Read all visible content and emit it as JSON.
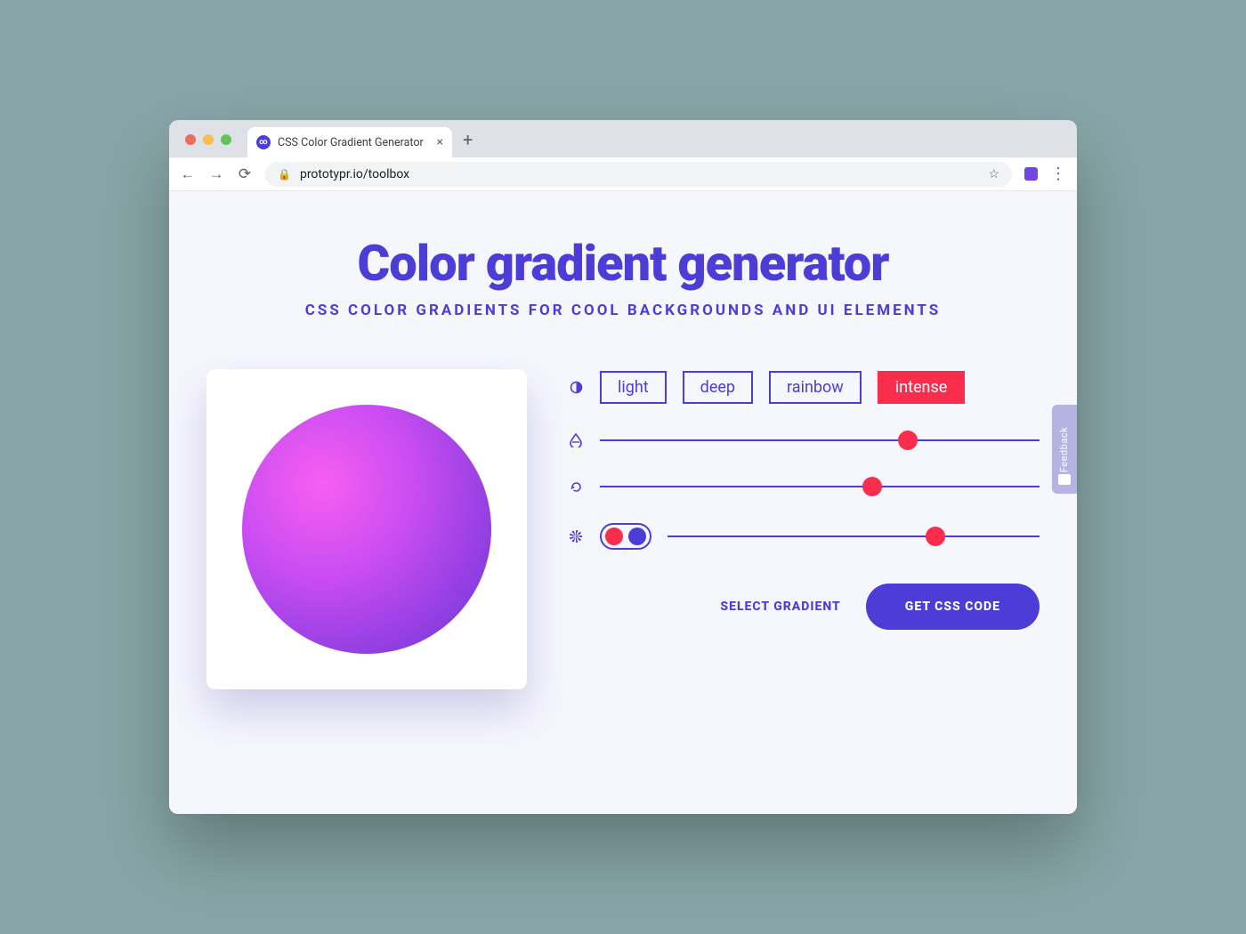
{
  "browser": {
    "tab_title": "CSS Color Gradient Generator",
    "url": "prototypr.io/toolbox"
  },
  "page": {
    "title": "Color gradient generator",
    "subtitle": "CSS COLOR GRADIENTS FOR COOL BACKGROUNDS AND UI ELEMENTS"
  },
  "style_options": {
    "items": [
      "light",
      "deep",
      "rainbow",
      "intense"
    ],
    "selected": "intense"
  },
  "sliders": {
    "intensity_pct": 70,
    "rotation_pct": 62,
    "third_pct": 72
  },
  "toggle": {
    "on": true
  },
  "actions": {
    "select_label": "SELECT GRADIENT",
    "css_label": "GET CSS CODE"
  },
  "feedback_label": "Feedback",
  "colors": {
    "primary": "#4b3dd6",
    "accent": "#f92e4c",
    "gradient_from": "#f85ef0",
    "gradient_to": "#8a3de0"
  }
}
